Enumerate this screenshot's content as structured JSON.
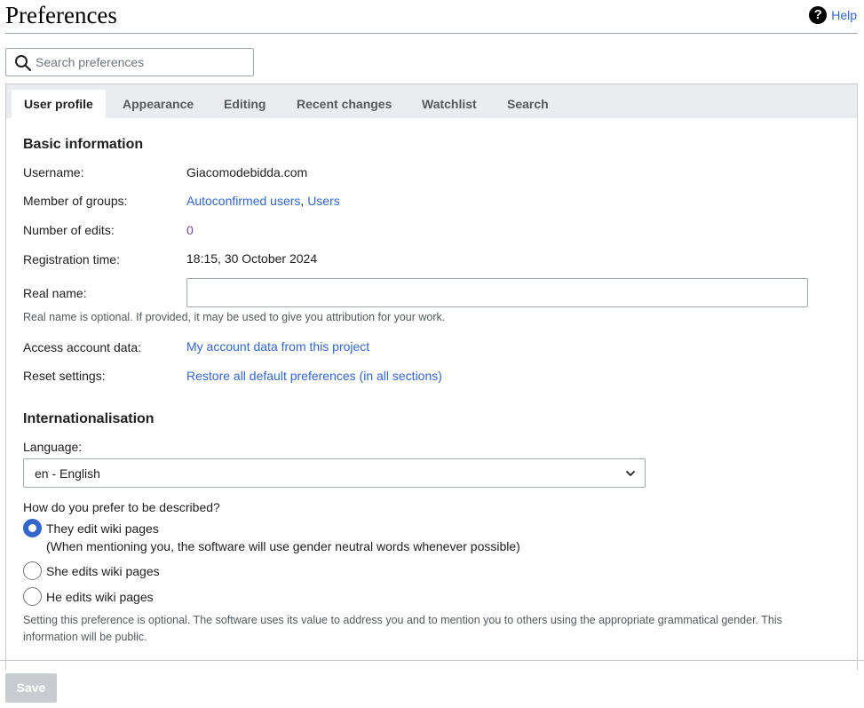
{
  "page": {
    "title": "Preferences",
    "help_label": "Help"
  },
  "search": {
    "placeholder": "Search preferences",
    "value": ""
  },
  "tabs": [
    {
      "label": "User profile",
      "active": true
    },
    {
      "label": "Appearance"
    },
    {
      "label": "Editing"
    },
    {
      "label": "Recent changes"
    },
    {
      "label": "Watchlist"
    },
    {
      "label": "Search"
    }
  ],
  "basic": {
    "title": "Basic information",
    "username_label": "Username:",
    "username_value": "Giacomodebidda.com",
    "groups_label": "Member of groups:",
    "groups": [
      "Autoconfirmed users",
      "Users"
    ],
    "groups_separator": ",",
    "edits_label": "Number of edits:",
    "edits_value": "0",
    "registration_label": "Registration time:",
    "registration_value": "18:15, 30 October 2024",
    "realname_label": "Real name:",
    "realname_value": "",
    "realname_help": "Real name is optional. If provided, it may be used to give you attribution for your work.",
    "access_label": "Access account data:",
    "access_link": "My account data from this project",
    "reset_label": "Reset settings:",
    "reset_link": "Restore all default preferences (in all sections)"
  },
  "intl": {
    "title": "Internationalisation",
    "language_label": "Language:",
    "language_value": "en - English",
    "gender_question": "How do you prefer to be described?",
    "options": [
      {
        "label": "They edit wiki pages",
        "sublabel": "(When mentioning you, the software will use gender neutral words whenever possible)",
        "checked": true
      },
      {
        "label": "She edits wiki pages",
        "checked": false
      },
      {
        "label": "He edits wiki pages",
        "checked": false
      }
    ],
    "gender_help": "Setting this preference is optional. The software uses its value to address you and to mention you to others using the appropriate grammatical gender. This information will be public."
  },
  "footer": {
    "save_label": "Save"
  },
  "icons": {
    "help": "help-icon",
    "search": "search-icon",
    "dropdown": "chevron-down-icon"
  },
  "colors": {
    "link": "#3366cc",
    "visited_link": "#6b4ba1",
    "accent": "#3366cc",
    "save_disabled": "#c8ccd1"
  }
}
